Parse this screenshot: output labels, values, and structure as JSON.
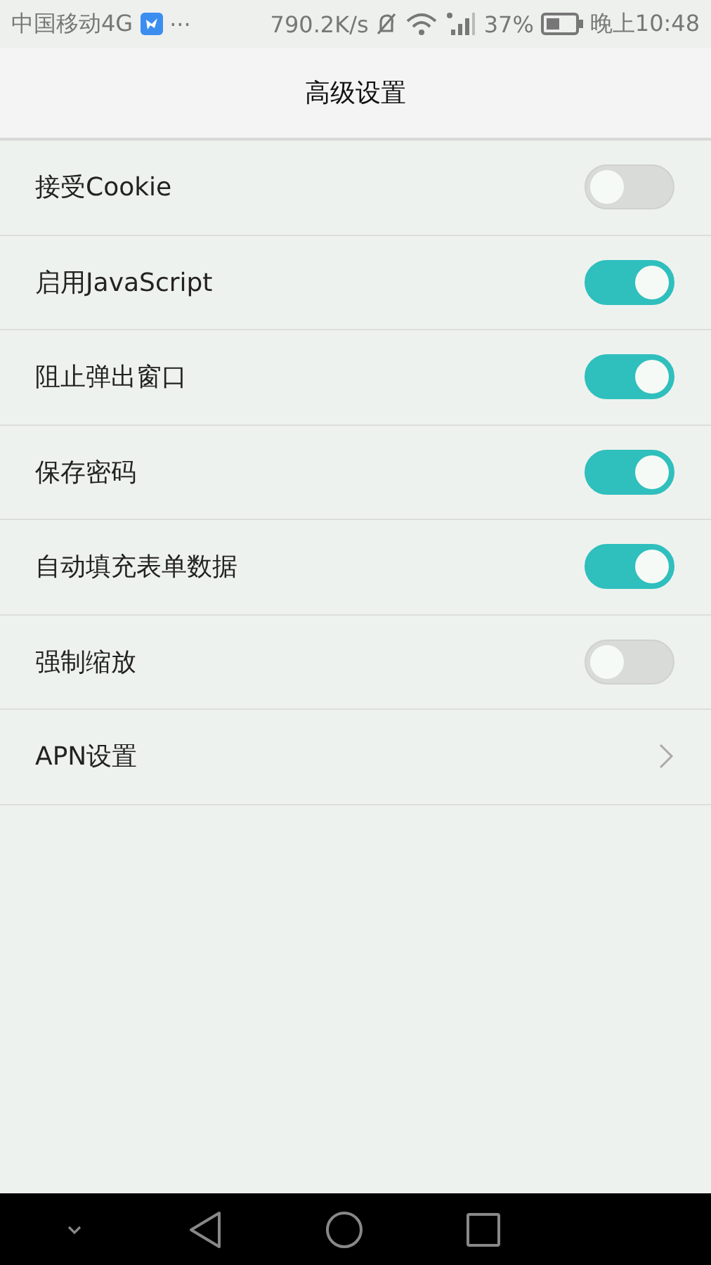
{
  "status_bar": {
    "carrier": "中国移动4G",
    "more": "···",
    "speed": "790.2K/s",
    "battery": "37%",
    "time": "晚上10:48"
  },
  "header": {
    "title": "高级设置"
  },
  "settings": [
    {
      "kind": "toggle",
      "label": "接受Cookie",
      "on": false
    },
    {
      "kind": "toggle",
      "label": "启用JavaScript",
      "on": true
    },
    {
      "kind": "toggle",
      "label": "阻止弹出窗口",
      "on": true
    },
    {
      "kind": "toggle",
      "label": "保存密码",
      "on": true
    },
    {
      "kind": "toggle",
      "label": "自动填充表单数据",
      "on": true
    },
    {
      "kind": "toggle",
      "label": "强制缩放",
      "on": false
    },
    {
      "kind": "link",
      "label": "APN设置"
    }
  ]
}
